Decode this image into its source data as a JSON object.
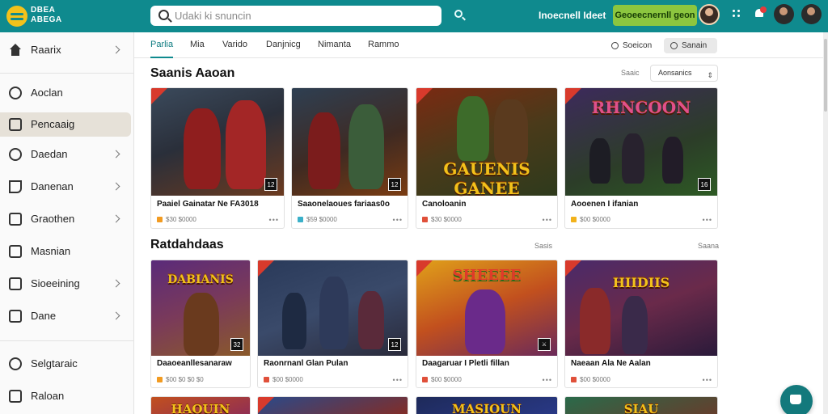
{
  "header": {
    "brand_line1": "DBEA",
    "brand_line2": "ABEGA",
    "search_placeholder": "Udaki ki snuncin",
    "link": "Inoecnell Ideet",
    "cta": "Geoeecnernll geon"
  },
  "sidebar": {
    "items": [
      {
        "label": "Raarix",
        "icon": "home-icon",
        "chevron": true
      },
      {
        "label": "Aoclan",
        "icon": "search-icon",
        "chevron": false
      },
      {
        "label": "Pencaaig",
        "icon": "folder-icon",
        "chevron": false,
        "active": true
      },
      {
        "label": "Daedan",
        "icon": "user-icon",
        "chevron": true
      },
      {
        "label": "Danenan",
        "icon": "pencil-icon",
        "chevron": true
      },
      {
        "label": "Graothen",
        "icon": "square-icon",
        "chevron": true
      },
      {
        "label": "Masnian",
        "icon": "edit-icon",
        "chevron": false
      },
      {
        "label": "Sioeeining",
        "icon": "chart-icon",
        "chevron": true
      },
      {
        "label": "Dane",
        "icon": "list-icon",
        "chevron": true
      },
      {
        "label": "Selgtaraic",
        "icon": "settings-icon",
        "chevron": false
      },
      {
        "label": "Raloan",
        "icon": "logout-icon",
        "chevron": false
      }
    ]
  },
  "tabs": [
    "Parlia",
    "Mia",
    "Varido",
    "Danjnicg",
    "Nimanta",
    "Rammo"
  ],
  "chips": {
    "a": "Soeicon",
    "b": "Sanain"
  },
  "sections": [
    {
      "title": "Saanis Aaoan",
      "sort_label": "Saaic",
      "sort_value": "Aonsanics",
      "cards": [
        {
          "title": "Paaiel Gainatar Ne FA3018",
          "meta": "$30 $0000",
          "accent": "#f29b21",
          "tag": "12",
          "logo": ""
        },
        {
          "title": "Saaonelaoues fariaas0o",
          "meta": "$59 $0000",
          "accent": "#3ab0c9",
          "tag": "12",
          "logo": ""
        },
        {
          "title": "Canoloanin",
          "meta": "$30 $0000",
          "accent": "#e0503a",
          "tag": "",
          "logo": "GAUENIS GANEE"
        },
        {
          "title": "Aooenen I ifanian",
          "meta": "$00 $0000",
          "accent": "#f2b21b",
          "tag": "16",
          "logo": "RHNCOON"
        }
      ]
    },
    {
      "title": "Ratdahdaas",
      "meta_a": "Sasis",
      "meta_b": "Saana",
      "cards": [
        {
          "title": "Daaoeanllesanaraw",
          "meta": "$00 $0 $0 $0",
          "accent": "#f29b21",
          "tag": "32",
          "logo": "DABIANIS"
        },
        {
          "title": "Raonrnanl Glan Pulan",
          "meta": "$00 $0000",
          "accent": "#e0503a",
          "tag": "12",
          "logo": ""
        },
        {
          "title": "Daagaruar I Pletli fillan",
          "meta": "$00 $0000",
          "accent": "#e0503a",
          "tag": "",
          "logo": "SHEEEE"
        },
        {
          "title": "Naeaan Ala Ne Aalan",
          "meta": "$00 $0000",
          "accent": "#e0503a",
          "tag": "",
          "logo": "HIIDIIS"
        }
      ]
    },
    {
      "cards": [
        {
          "logo": "HAOUIN"
        },
        {
          "logo": ""
        },
        {
          "logo": "MASIOUN"
        },
        {
          "logo": "SIAU"
        }
      ]
    }
  ],
  "colors": {
    "topbar": "#0f8a8e",
    "cta": "#8cc63f",
    "accent": "#0f7c81"
  }
}
